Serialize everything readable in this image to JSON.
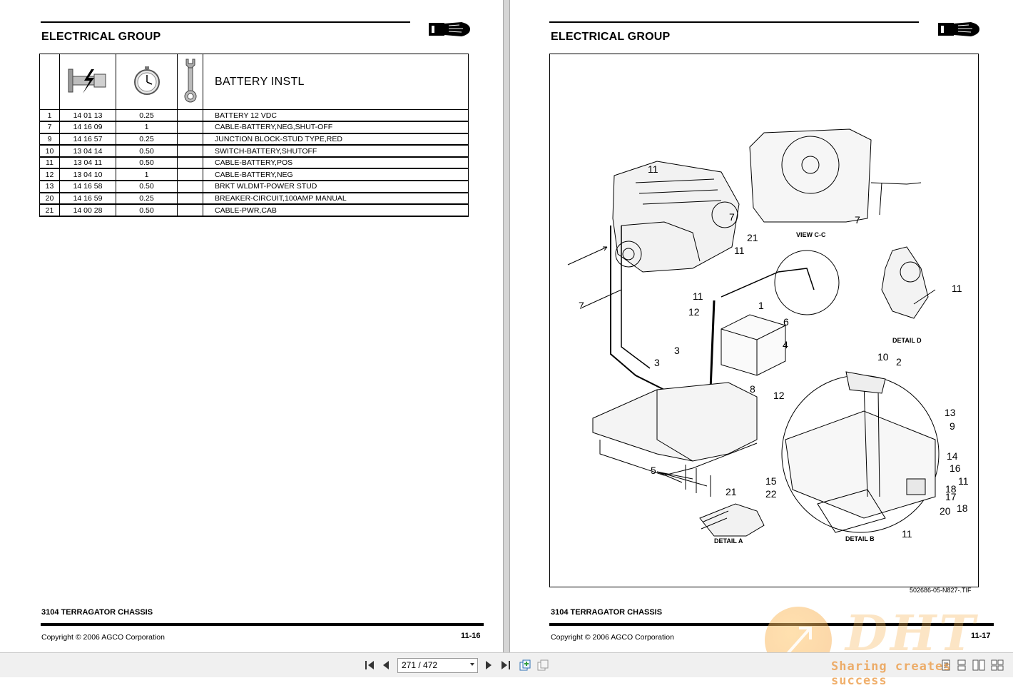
{
  "left_page": {
    "group_title": "ELECTRICAL GROUP",
    "sheet_title": "BATTERY INSTL",
    "rows": [
      {
        "ref": "1",
        "part": "14 01 13",
        "time": "0.25",
        "tool": "",
        "desc": "BATTERY 12 VDC"
      },
      {
        "ref": "7",
        "part": "14 16 09",
        "time": "1",
        "tool": "",
        "desc": "CABLE-BATTERY,NEG,SHUT-OFF"
      },
      {
        "ref": "9",
        "part": "14 16 57",
        "time": "0.25",
        "tool": "",
        "desc": "JUNCTION BLOCK-STUD TYPE,RED"
      },
      {
        "ref": "10",
        "part": "13 04 14",
        "time": "0.50",
        "tool": "",
        "desc": "SWITCH-BATTERY,SHUTOFF"
      },
      {
        "ref": "11",
        "part": "13 04 11",
        "time": "0.50",
        "tool": "",
        "desc": "CABLE-BATTERY,POS"
      },
      {
        "ref": "12",
        "part": "13 04 10",
        "time": "1",
        "tool": "",
        "desc": "CABLE-BATTERY,NEG"
      },
      {
        "ref": "13",
        "part": "14 16 58",
        "time": "0.50",
        "tool": "",
        "desc": "BRKT WLDMT-POWER STUD"
      },
      {
        "ref": "20",
        "part": "14 16 59",
        "time": "0.25",
        "tool": "",
        "desc": "BREAKER-CIRCUIT,100AMP MANUAL"
      },
      {
        "ref": "21",
        "part": "14 00 28",
        "time": "0.50",
        "tool": "",
        "desc": "CABLE-PWR,CAB"
      }
    ],
    "footer_title": "3104 TERRAGATOR CHASSIS",
    "copyright": "Copyright © 2006 AGCO Corporation",
    "page_number": "11-16"
  },
  "right_page": {
    "group_title": "ELECTRICAL GROUP",
    "callouts": [
      "11",
      "21",
      "11",
      "7",
      "7",
      "11",
      "12",
      "1",
      "6",
      "4",
      "3",
      "3",
      "8",
      "7",
      "11",
      "5",
      "21",
      "10",
      "2",
      "12",
      "13",
      "9",
      "14",
      "16",
      "11",
      "18",
      "17",
      "20",
      "18",
      "15",
      "22",
      "11"
    ],
    "view_labels": {
      "view_cc": "VIEW C-C",
      "detail_a": "DETAIL A",
      "detail_b": "DETAIL B",
      "detail_d": "DETAIL D"
    },
    "figure_file": "502686-05-N827-.TIF",
    "footer_title": "3104 TERRAGATOR CHASSIS",
    "copyright": "Copyright © 2006 AGCO Corporation",
    "page_number": "11-17"
  },
  "toolbar": {
    "page_indicator": "271 / 472",
    "icons": [
      "first-page-icon",
      "prev-page-icon",
      "next-page-icon",
      "last-page-icon",
      "extract-pages-icon",
      "copy-pages-icon"
    ],
    "right_icons": [
      "single-page-icon",
      "continuous-icon",
      "two-page-icon",
      "two-page-continuous-icon"
    ]
  },
  "watermark": {
    "brand": "DHT",
    "tagline": "Sharing creates success"
  },
  "colors": {
    "ink": "#000000",
    "gutter": "#d6d6d6",
    "toolbar": "#f0f0f0",
    "watermark_orange": "#f5a03c"
  }
}
